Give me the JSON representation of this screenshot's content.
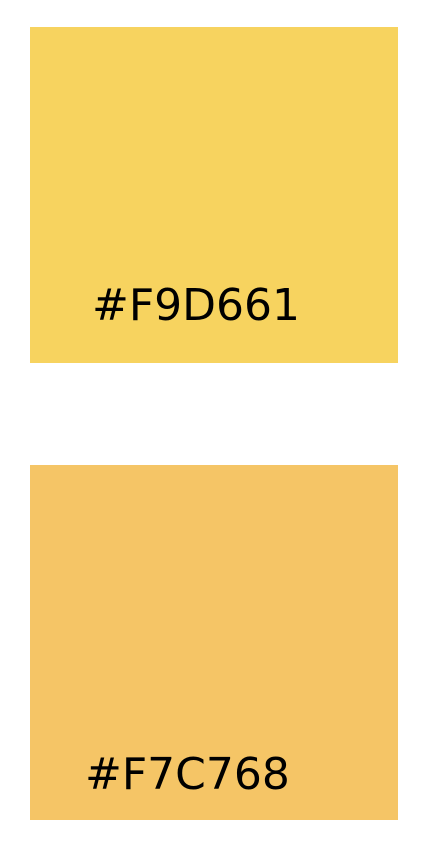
{
  "swatches": [
    {
      "label": "#F9D661",
      "color": "#F7D35F"
    },
    {
      "label": "#F7C768",
      "color": "#F5C566"
    }
  ]
}
